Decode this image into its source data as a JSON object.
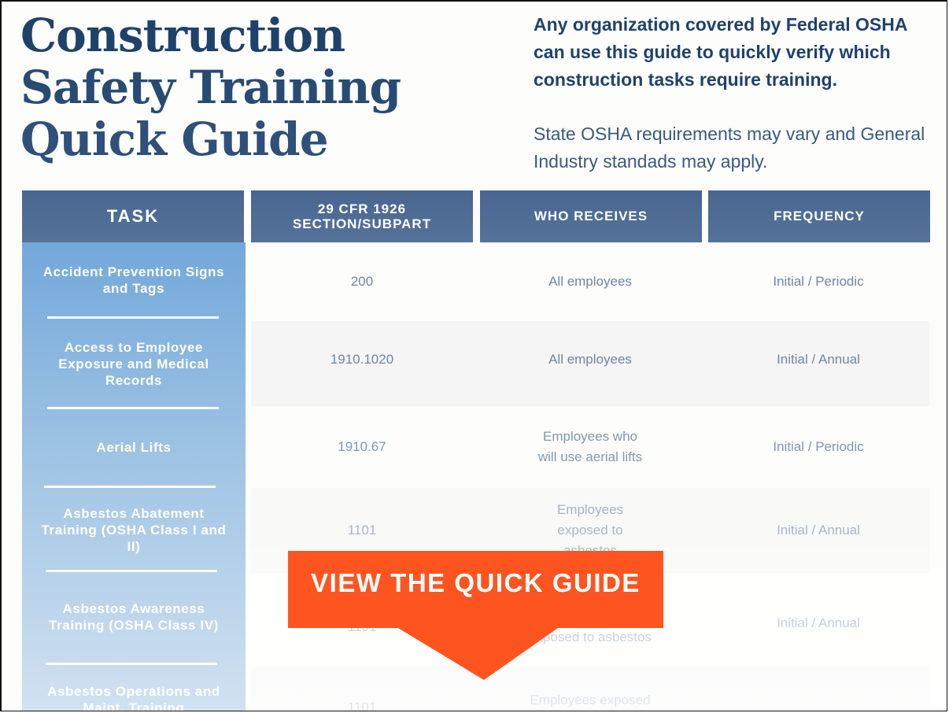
{
  "title": {
    "lines": [
      "Construction",
      "Safety Training",
      "Quick Guide"
    ]
  },
  "intro": {
    "bold": "Any organization covered by Federal OSHA can use this guide to quickly verify which construction tasks require training.",
    "light": "State OSHA requirements may vary and General Industry standads may apply."
  },
  "table": {
    "headers": {
      "task": "TASK",
      "cfr_line1": "29 CFR 1926",
      "cfr_line2": "SECTION/SUBPART",
      "who": "WHO RECEIVES",
      "frequency": "FREQUENCY"
    },
    "rows": [
      {
        "task": "Accident Prevention Signs and Tags",
        "cfr": "200",
        "who": "All employees",
        "frequency": "Initial / Periodic"
      },
      {
        "task": "Access to Employee Exposure and Medical Records",
        "cfr": "1910.1020",
        "who": "All employees",
        "frequency": "Initial / Annual"
      },
      {
        "task": "Aerial Lifts",
        "cfr": "1910.67",
        "who": "Employees who will use aerial lifts",
        "frequency": "Initial / Periodic"
      },
      {
        "task": "Asbestos Abatement Training (OSHA Class I and II)",
        "cfr": "1101",
        "who": "Employees exposed to asbestos",
        "frequency": "Initial / Annual"
      },
      {
        "task": "Asbestos Awareness Training (OSHA Class IV)",
        "cfr": "1101",
        "who": "Employees potentially exposed to asbestos",
        "frequency": "Initial / Annual"
      },
      {
        "task": "Asbestos Operations and Maint. Training",
        "cfr": "1101",
        "who": "Employees exposed",
        "frequency": ""
      }
    ]
  },
  "cta": {
    "label": "VIEW THE QUICK GUIDE",
    "color": "#fe5520"
  },
  "colors": {
    "title": "#1f426b",
    "header_bg": "#4d6b93",
    "task_col_top": "#73a8da",
    "cell_text": "#6f86a6"
  }
}
